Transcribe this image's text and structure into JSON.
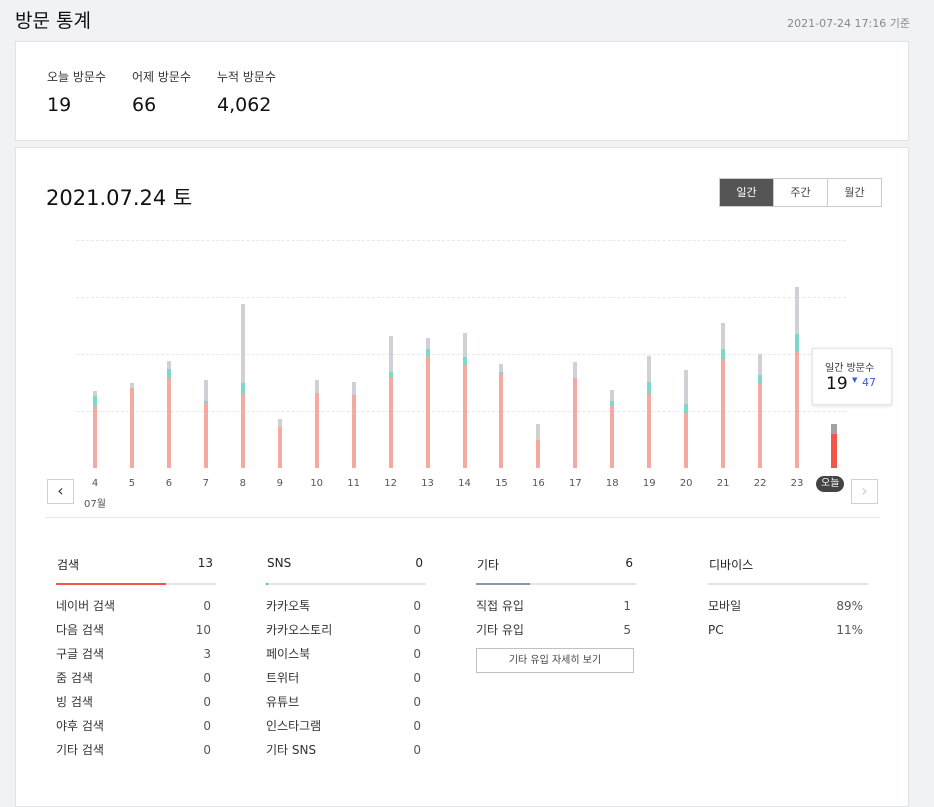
{
  "header": {
    "title": "방문 통계",
    "updated": "2021-07-24 17:16 기준"
  },
  "summary": {
    "today_label": "오늘 방문수",
    "today_value": "19",
    "yesterday_label": "어제 방문수",
    "yesterday_value": "66",
    "total_label": "누적 방문수",
    "total_value": "4,062"
  },
  "chart": {
    "date_heading": "2021.07.24 토",
    "period_tabs": [
      "일간",
      "주간",
      "월간"
    ],
    "active_tab": "일간",
    "month_label": "07월",
    "today_label": "오늘",
    "nav_prev": "‹",
    "nav_next": "›",
    "tooltip": {
      "label": "일간 방문수",
      "value": "19",
      "trend_icon": "triangle-down-icon",
      "trend_glyph": "▼",
      "compare": "47"
    }
  },
  "chart_data": {
    "type": "bar",
    "categories": [
      "4",
      "5",
      "6",
      "7",
      "8",
      "9",
      "10",
      "11",
      "12",
      "13",
      "14",
      "15",
      "16",
      "17",
      "18",
      "19",
      "20",
      "21",
      "22",
      "23",
      "오늘"
    ],
    "series": [
      {
        "name": "검색",
        "values": [
          38,
          49,
          56,
          40,
          46,
          25,
          46,
          44,
          56,
          69,
          63,
          58,
          17,
          55,
          38,
          46,
          34,
          67,
          52,
          71,
          21
        ]
      },
      {
        "name": "SNS",
        "values": [
          6,
          0,
          5,
          1,
          6,
          0,
          0,
          1,
          3,
          4,
          5,
          1,
          0,
          0,
          3,
          7,
          5,
          6,
          5,
          11,
          0
        ]
      },
      {
        "name": "기타",
        "values": [
          3,
          3,
          5,
          13,
          49,
          5,
          8,
          8,
          22,
          7,
          15,
          5,
          10,
          10,
          7,
          16,
          21,
          16,
          13,
          29,
          6
        ]
      }
    ],
    "ylim": [
      0,
      140
    ],
    "colors": {
      "검색": "#f5aaa1",
      "SNS": "#7ed8c9",
      "기타": "#cfd1d4",
      "today_search": "#f0584a",
      "today_other": "#9ea3a8"
    }
  },
  "breakdown": {
    "search": {
      "title": "검색",
      "total": "13",
      "color": "#f0584a",
      "rows": [
        {
          "label": "네이버 검색",
          "value": "0"
        },
        {
          "label": "다음 검색",
          "value": "10"
        },
        {
          "label": "구글 검색",
          "value": "3"
        },
        {
          "label": "줌 검색",
          "value": "0"
        },
        {
          "label": "빙 검색",
          "value": "0"
        },
        {
          "label": "야후 검색",
          "value": "0"
        },
        {
          "label": "기타 검색",
          "value": "0"
        }
      ]
    },
    "sns": {
      "title": "SNS",
      "total": "0",
      "color": "#3cc7a6",
      "rows": [
        {
          "label": "카카오톡",
          "value": "0"
        },
        {
          "label": "카카오스토리",
          "value": "0"
        },
        {
          "label": "페이스북",
          "value": "0"
        },
        {
          "label": "트위터",
          "value": "0"
        },
        {
          "label": "유튜브",
          "value": "0"
        },
        {
          "label": "인스타그램",
          "value": "0"
        },
        {
          "label": "기타 SNS",
          "value": "0"
        }
      ]
    },
    "other": {
      "title": "기타",
      "total": "6",
      "color": "#8d97a3",
      "rows": [
        {
          "label": "직접 유입",
          "value": "1"
        },
        {
          "label": "기타 유입",
          "value": "5"
        }
      ],
      "detail_button": "기타 유입 자세히 보기"
    },
    "device": {
      "title": "디바이스",
      "rows": [
        {
          "label": "모바일",
          "value": "89%"
        },
        {
          "label": "PC",
          "value": "11%"
        }
      ]
    }
  }
}
